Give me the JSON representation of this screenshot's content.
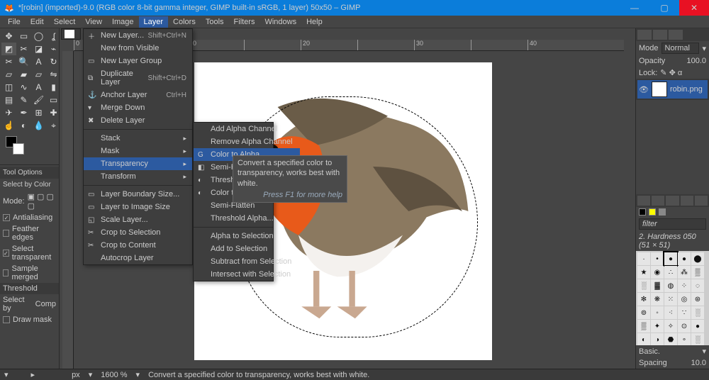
{
  "titlebar": {
    "title": "*[robin] (imported)-9.0 (RGB color 8-bit gamma integer, GIMP built-in sRGB, 1 layer) 50x50 – GIMP"
  },
  "menubar": {
    "items": [
      "File",
      "Edit",
      "Select",
      "View",
      "Image",
      "Layer",
      "Colors",
      "Tools",
      "Filters",
      "Windows",
      "Help"
    ],
    "active": "Layer"
  },
  "layer_menu": {
    "items": [
      {
        "label": "New Layer...",
        "shortcut": "Shift+Ctrl+N",
        "icon": "＋"
      },
      {
        "label": "New from Visible"
      },
      {
        "label": "New Layer Group",
        "icon": "▭"
      },
      {
        "label": "Duplicate Layer",
        "shortcut": "Shift+Ctrl+D",
        "icon": "⧉"
      },
      {
        "label": "Anchor Layer",
        "shortcut": "Ctrl+H",
        "disabled": true,
        "icon": "⚓"
      },
      {
        "label": "Merge Down",
        "disabled": true,
        "icon": "▾"
      },
      {
        "label": "Delete Layer",
        "icon": "✖"
      },
      {
        "sep": true
      },
      {
        "label": "Stack",
        "submenu": true
      },
      {
        "label": "Mask",
        "submenu": true
      },
      {
        "label": "Transparency",
        "submenu": true,
        "hl": true
      },
      {
        "label": "Transform",
        "submenu": true
      },
      {
        "sep": true
      },
      {
        "label": "Layer Boundary Size...",
        "icon": "▭"
      },
      {
        "label": "Layer to Image Size",
        "icon": "▭"
      },
      {
        "label": "Scale Layer...",
        "icon": "◱"
      },
      {
        "label": "Crop to Selection",
        "icon": "✂"
      },
      {
        "label": "Crop to Content",
        "icon": "✂"
      },
      {
        "label": "Autocrop Layer"
      }
    ]
  },
  "transparency_menu": {
    "items": [
      {
        "label": "Add Alpha Channel",
        "disabled": true
      },
      {
        "label": "Remove Alpha Channel"
      },
      {
        "label": "Color to Alpha...",
        "hl": true,
        "icon": "G"
      },
      {
        "label": "Semi-Flatten",
        "icon": "◧"
      },
      {
        "label": "Threshold Alpha...",
        "icon": "◐"
      },
      {
        "label": "Color to Alpha...",
        "icon": "◐"
      },
      {
        "label": "Semi-Flatten"
      },
      {
        "label": "Threshold Alpha..."
      },
      {
        "sep": true
      },
      {
        "label": "Alpha to Selection"
      },
      {
        "label": "Add to Selection"
      },
      {
        "label": "Subtract from Selection"
      },
      {
        "label": "Intersect with Selection"
      }
    ]
  },
  "tooltip": {
    "text": "Convert a specified color to transparency, works best with white.",
    "hint": "Press F1 for more help"
  },
  "tool_options": {
    "title": "Tool Options",
    "subtitle": "Select by Color",
    "mode": "Mode:",
    "antialiasing": "Antialiasing",
    "feather": "Feather edges",
    "transparent": "Select transparent",
    "merged": "Sample merged",
    "threshold": "Threshold",
    "selectby": "Select by",
    "comp": "Comp",
    "drawmask": "Draw mask"
  },
  "canvas": {
    "zoom": "1600 %",
    "unit": "px"
  },
  "statusbar": {
    "message": "Convert a specified color to transparency, works best with white."
  },
  "right": {
    "mode_label": "Mode",
    "mode_value": "Normal",
    "opacity_label": "Opacity",
    "opacity_value": "100.0",
    "lock_label": "Lock:",
    "layer_name": "robin.png",
    "filter_label": "filter",
    "brush_label": "2. Hardness 050 (51 × 51)",
    "basic": "Basic.",
    "spacing_label": "Spacing",
    "spacing_value": "10.0"
  },
  "ruler_ticks": [
    "0",
    " ",
    "10",
    " ",
    "20",
    " ",
    "30",
    " ",
    "40"
  ]
}
